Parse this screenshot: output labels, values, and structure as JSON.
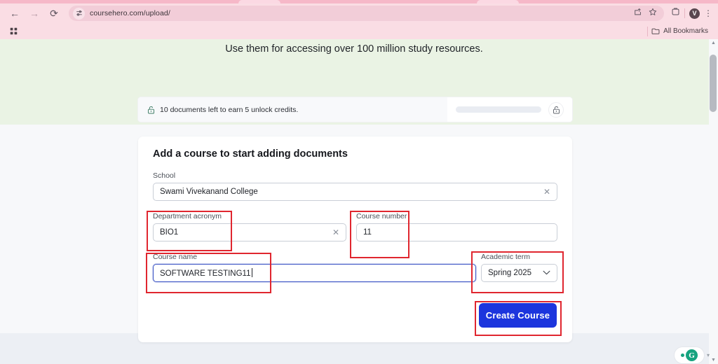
{
  "browser": {
    "url": "coursehero.com/upload/",
    "back_icon": "back-arrow-icon",
    "forward_icon": "forward-arrow-icon",
    "reload_icon": "reload-icon",
    "site_settings_icon": "site-settings-icon",
    "share_icon": "share-icon",
    "bookmark_icon": "star-icon",
    "extensions_icon": "extensions-icon",
    "profile_initial": "V",
    "menu_icon": "three-dot-menu-icon",
    "apps_icon": "apps-grid-icon",
    "bookmarks_label": "All Bookmarks",
    "bookmarks_folder_icon": "folder-icon"
  },
  "page": {
    "banner_text": "Use them for accessing over 100 million study resources.",
    "credits": {
      "lock_icon": "unlock-icon",
      "text": "10 documents left to earn 5 unlock credits.",
      "progress_percent": 0,
      "unlock_badge_icon": "unlock-icon"
    },
    "card": {
      "title": "Add a course to start adding documents",
      "fields": {
        "school": {
          "label": "School",
          "value": "Swami Vivekanand College",
          "clear_icon": "clear-x-icon"
        },
        "department_acronym": {
          "label": "Department acronym",
          "value": "BIO1",
          "clear_icon": "clear-x-icon"
        },
        "course_number": {
          "label": "Course number",
          "value": "11"
        },
        "course_name": {
          "label": "Course name",
          "value": "SOFTWARE TESTING11",
          "focused": true
        },
        "academic_term": {
          "label": "Academic term",
          "value": "Spring 2025",
          "chevron_icon": "chevron-down-icon"
        }
      },
      "submit_label": "Create Course"
    },
    "grammarly": {
      "logo_letter": "G",
      "caret_icon": "caret-down-icon"
    }
  },
  "colors": {
    "chrome_pink": "#fadde4",
    "green_band": "#eaf3e4",
    "accent_blue": "#1c35dd",
    "focus_blue": "#3a52c4",
    "annotation_red": "#e0262f",
    "grammarly_green": "#17a37f"
  }
}
